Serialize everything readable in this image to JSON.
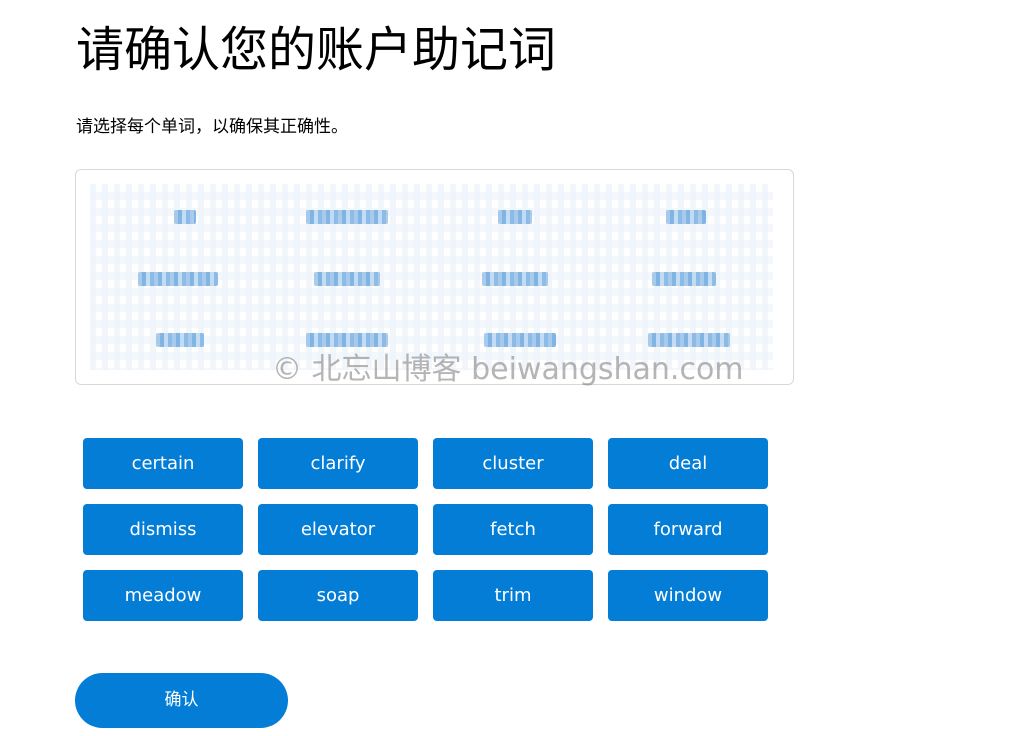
{
  "header": {
    "title": "请确认您的账户助记词",
    "subtitle": "请选择每个单词，以确保其正确性。"
  },
  "phrase_box": {
    "watermark": "© 北忘山博客 beiwangshan.com"
  },
  "word_options": [
    "certain",
    "clarify",
    "cluster",
    "deal",
    "dismiss",
    "elevator",
    "fetch",
    "forward",
    "meadow",
    "soap",
    "trim",
    "window"
  ],
  "actions": {
    "confirm_label": "确认"
  },
  "colors": {
    "accent": "#037dd6",
    "button_text": "#ffffff",
    "border": "#d6d9dc"
  }
}
